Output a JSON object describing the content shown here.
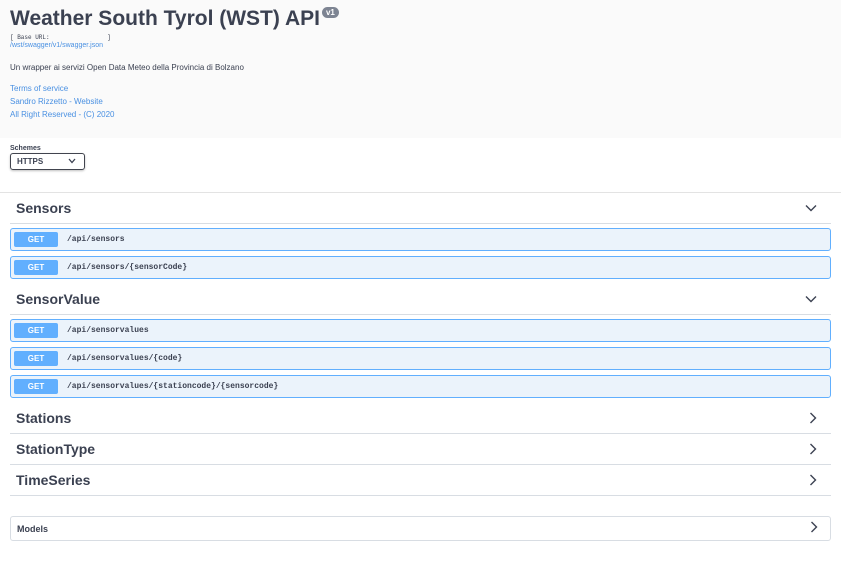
{
  "info": {
    "title": "Weather South Tyrol (WST) API",
    "version": "v1",
    "base_url": "[ Base URL:                ]",
    "swagger_link": "/wst/swagger/v1/swagger.json",
    "description": "Un wrapper ai servizi Open Data Meteo della Provincia di Bolzano",
    "links": [
      "Terms of service",
      "Sandro Rizzetto - Website",
      "All Right Reserved - (C) 2020"
    ]
  },
  "schemes": {
    "label": "Schemes",
    "selected": "HTTPS"
  },
  "tags": [
    {
      "name": "Sensors",
      "expanded": true,
      "operations": [
        {
          "method": "GET",
          "path": "/api/sensors"
        },
        {
          "method": "GET",
          "path": "/api/sensors/{sensorCode}"
        }
      ]
    },
    {
      "name": "SensorValue",
      "expanded": true,
      "operations": [
        {
          "method": "GET",
          "path": "/api/sensorvalues"
        },
        {
          "method": "GET",
          "path": "/api/sensorvalues/{code}"
        },
        {
          "method": "GET",
          "path": "/api/sensorvalues/{stationcode}/{sensorcode}"
        }
      ]
    },
    {
      "name": "Stations",
      "expanded": false,
      "operations": []
    },
    {
      "name": "StationType",
      "expanded": false,
      "operations": []
    },
    {
      "name": "TimeSeries",
      "expanded": false,
      "operations": []
    }
  ],
  "models": {
    "label": "Models"
  },
  "colors": {
    "get_accent": "#61affe",
    "get_bg": "#ebf3fb",
    "link": "#4990e2"
  },
  "icons": {
    "expanded": "chevron-down-icon",
    "collapsed": "chevron-right-icon"
  }
}
